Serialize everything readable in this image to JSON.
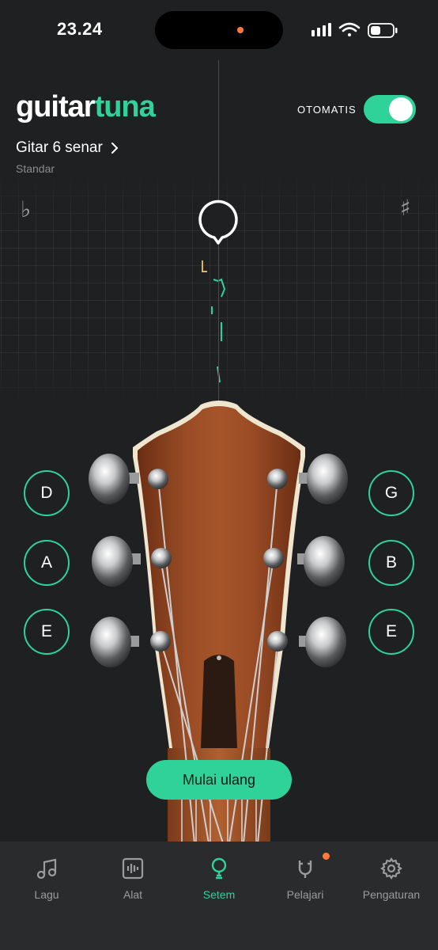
{
  "status": {
    "time": "23.24"
  },
  "header": {
    "logo_part1": "guitar",
    "logo_part2": "tuna",
    "auto_label": "OTOMATIS",
    "auto_enabled": true,
    "instrument": "Gitar 6 senar",
    "tuning": "Standar"
  },
  "meter": {
    "flat_symbol": "♭",
    "sharp_symbol": "♯"
  },
  "strings": {
    "left": [
      "D",
      "A",
      "E"
    ],
    "right": [
      "G",
      "B",
      "E"
    ]
  },
  "restart_label": "Mulai ulang",
  "tabs": [
    {
      "label": "Lagu",
      "icon": "music-note-icon",
      "active": false
    },
    {
      "label": "Alat",
      "icon": "waveform-icon",
      "active": false
    },
    {
      "label": "Setem",
      "icon": "tuner-pick-icon",
      "active": true
    },
    {
      "label": "Pelajari",
      "icon": "magnet-icon",
      "active": false
    },
    {
      "label": "Pengaturan",
      "icon": "gear-icon",
      "active": false
    }
  ],
  "colors": {
    "accent": "#2fd39a",
    "background": "#1f2021",
    "notification": "#ff7a3d"
  }
}
